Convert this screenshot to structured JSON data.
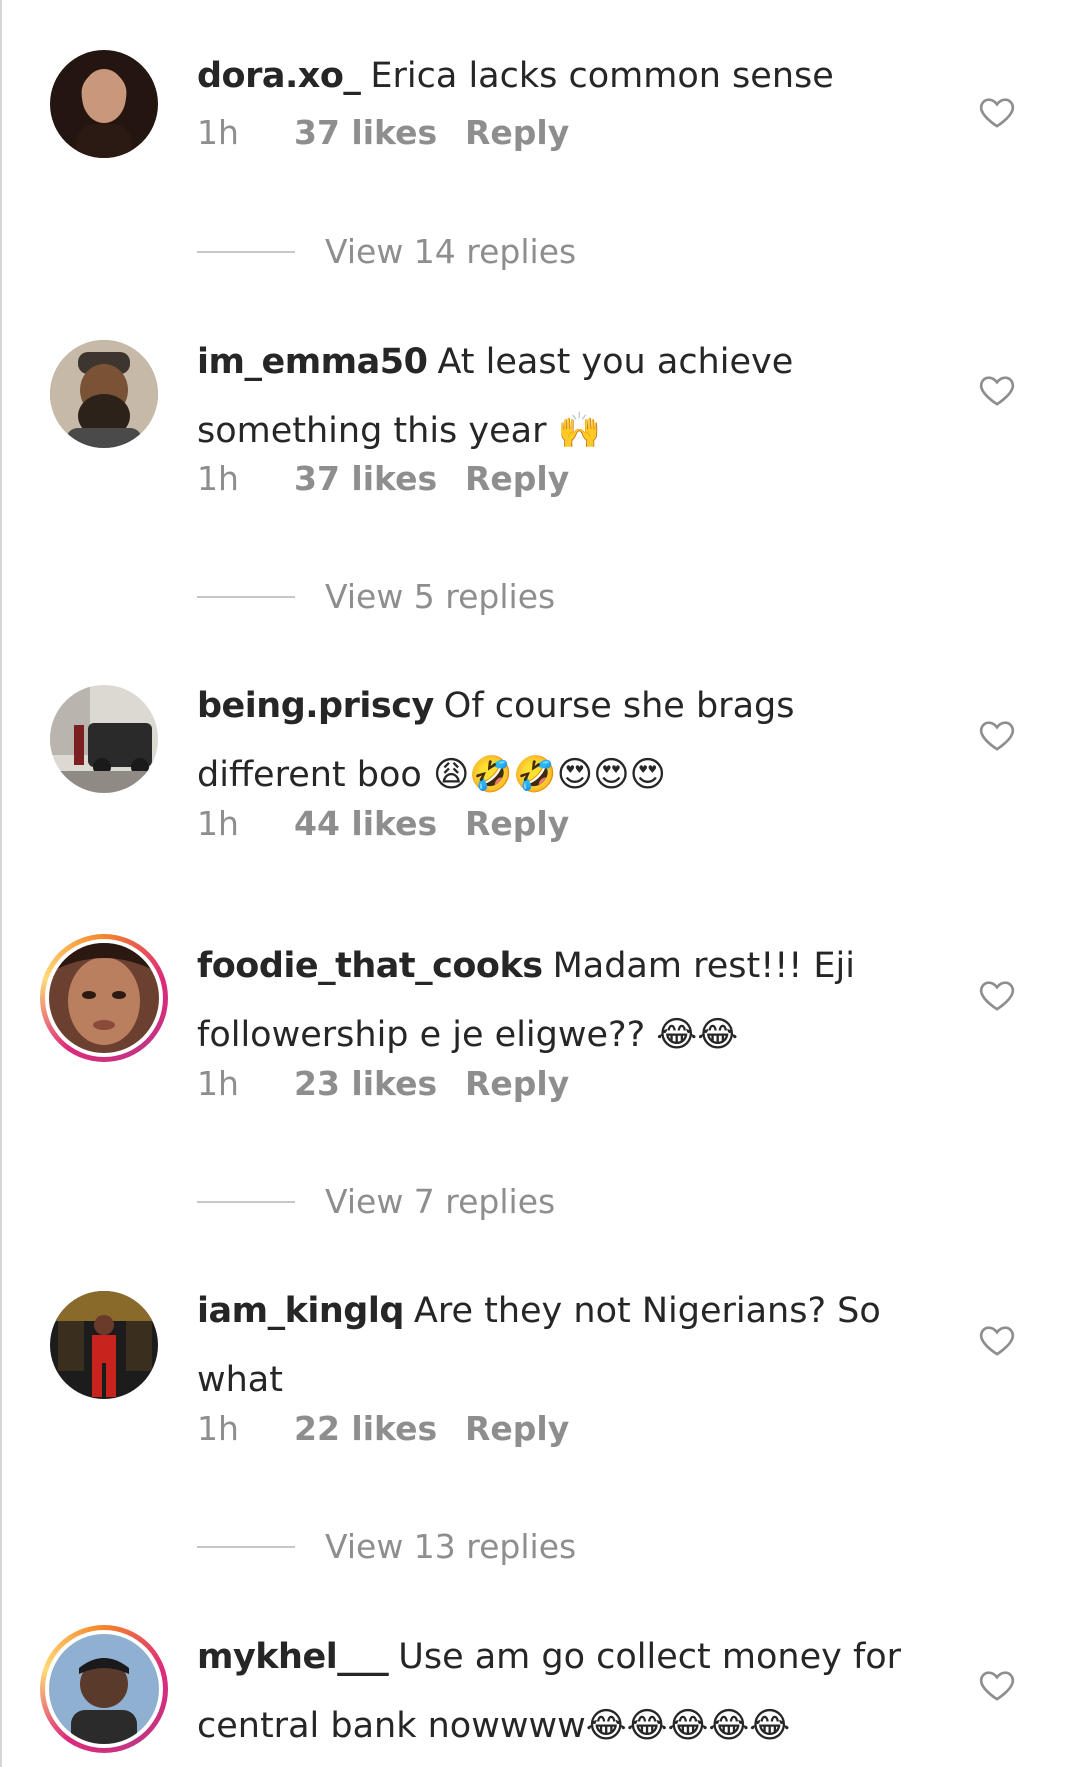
{
  "comments": [
    {
      "username": "dora.xo_",
      "text": "Erica lacks  common sense",
      "time": "1h",
      "likes": "37 likes",
      "reply": "Reply",
      "view_replies": "View 14 replies",
      "avatar_colors": [
        "#c9a892",
        "#2b1a14"
      ]
    },
    {
      "username": "im_emma50",
      "text": "At least you achieve something this year 🙌",
      "time": "1h",
      "likes": "37 likes",
      "reply": "Reply",
      "view_replies": "View 5 replies",
      "avatar_colors": [
        "#8a6a4e",
        "#3a2a1f"
      ]
    },
    {
      "username": "being.priscy",
      "text": "Of course she brags different boo 😩🤣🤣😍😍😍",
      "time": "1h",
      "likes": "44 likes",
      "reply": "Reply",
      "avatar_colors": [
        "#d8d4cf",
        "#2a2a2a"
      ]
    },
    {
      "username": "foodie_that_cooks",
      "text": "Madam rest!!! Eji followership e je eligwe?? 😂😂",
      "time": "1h",
      "likes": "23 likes",
      "reply": "Reply",
      "view_replies": "View 7 replies",
      "avatar_colors": [
        "#c18a6b",
        "#3b2418"
      ]
    },
    {
      "username": "iam_kinglq",
      "text": "Are they not Nigerians? So what",
      "time": "1h",
      "likes": "22 likes",
      "reply": "Reply",
      "view_replies": "View 13 replies",
      "avatar_colors": [
        "#b88a3a",
        "#c8231d"
      ]
    },
    {
      "username": "mykhel___",
      "text": "Use am go collect money for central bank nowwww😂😂😂😂😂",
      "avatar_colors": [
        "#7ba0c6",
        "#2b2b2b"
      ]
    }
  ],
  "icons": {
    "like": "heart-icon"
  },
  "colors": {
    "text": "#262626",
    "muted": "#8e8e8e",
    "divider": "#c7c7c7"
  }
}
